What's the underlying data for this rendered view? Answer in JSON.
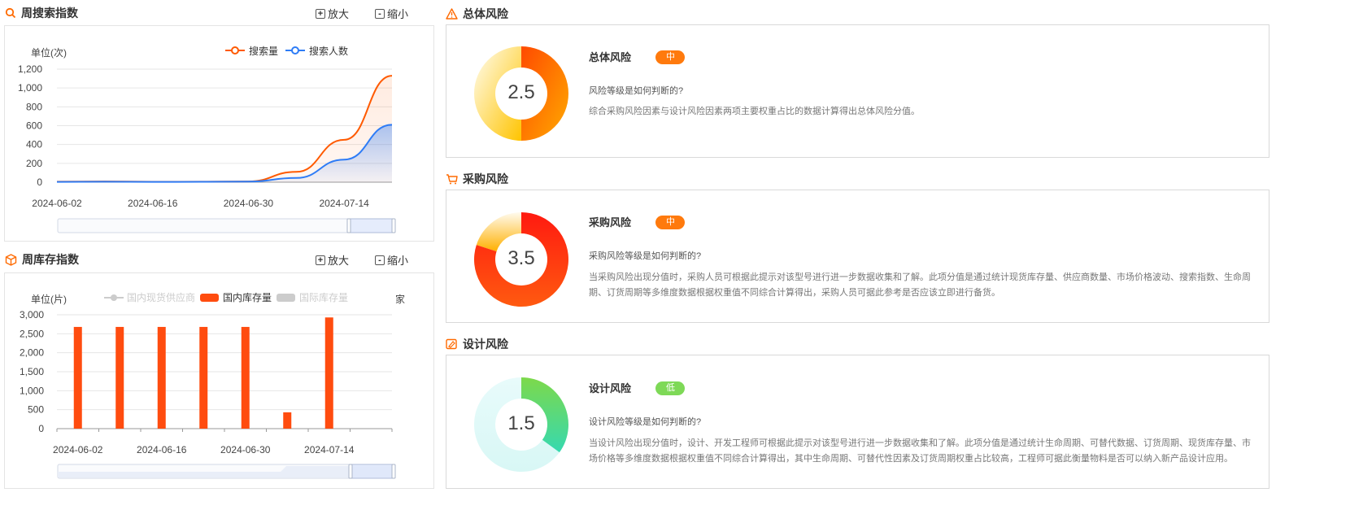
{
  "search_section": {
    "title": "周搜索指数",
    "zoom_in": "放大",
    "zoom_out": "缩小",
    "unit": "单位(次)",
    "zoom_in_symbol": "+",
    "zoom_out_symbol": "-"
  },
  "inventory_section": {
    "title": "周库存指数",
    "zoom_in": "放大",
    "zoom_out": "缩小",
    "unit": "单位(片)",
    "right_unit": "家",
    "zoom_in_symbol": "+",
    "zoom_out_symbol": "-"
  },
  "chart_data": [
    {
      "type": "line",
      "x": [
        "2024-06-02",
        "2024-06-09",
        "2024-06-16",
        "2024-06-23",
        "2024-06-30",
        "2024-07-07",
        "2024-07-14",
        "2024-07-21"
      ],
      "x_tick_labels": [
        "2024-06-02",
        "2024-06-16",
        "2024-06-30",
        "2024-07-14"
      ],
      "series": [
        {
          "name": "搜索量",
          "color": "#ff5a00",
          "values": [
            5,
            8,
            4,
            5,
            8,
            110,
            450,
            1130
          ]
        },
        {
          "name": "搜索人数",
          "color": "#2e7cf6",
          "values": [
            3,
            5,
            3,
            4,
            6,
            45,
            240,
            610
          ]
        }
      ],
      "ylim": [
        0,
        1200
      ],
      "yticks": [
        "0",
        "200",
        "400",
        "600",
        "800",
        "1,000",
        "1,200"
      ],
      "ylabel": "单位(次)",
      "legend_position": "top",
      "grid": true
    },
    {
      "type": "bar",
      "categories": [
        "2024-06-02",
        "2024-06-09",
        "2024-06-16",
        "2024-06-23",
        "2024-06-30",
        "2024-07-07",
        "2024-07-14"
      ],
      "x_tick_labels": [
        "2024-06-02",
        "2024-06-16",
        "2024-06-30",
        "2024-07-14"
      ],
      "series": [
        {
          "name": "国内现货供应商",
          "color": "#cccccc",
          "values": [],
          "disabled": true
        },
        {
          "name": "国内库存量",
          "color": "#ff4c0f",
          "values": [
            2680,
            2680,
            2680,
            2680,
            2680,
            430,
            2930
          ]
        },
        {
          "name": "国际库存量",
          "color": "#cccccc",
          "values": [],
          "disabled": true
        }
      ],
      "ylim": [
        0,
        3000
      ],
      "yticks": [
        "0",
        "500",
        "1,000",
        "1,500",
        "2,000",
        "2,500",
        "3,000"
      ],
      "ylabel": "单位(片)",
      "legend_position": "top",
      "grid": true
    }
  ],
  "risks": [
    {
      "section_title": "总体风险",
      "icon": "warning-icon",
      "score": "2.5",
      "score_fraction": 0.5,
      "name": "总体风险",
      "level": "中",
      "level_color": "#ff7a0d",
      "question": "风险等级是如何判断的?",
      "description": "综合采购风险因素与设计风险因素两项主要权重占比的数据计算得出总体风险分值。"
    },
    {
      "section_title": "采购风险",
      "icon": "cart-icon",
      "score": "3.5",
      "score_fraction": 0.7,
      "name": "采购风险",
      "level": "中",
      "level_color": "#ff7a0d",
      "question": "采购风险等级是如何判断的?",
      "description": "当采购风险出现分值时，采购人员可根据此提示对该型号进行进一步数据收集和了解。此项分值是通过统计现货库存量、供应商数量、市场价格波动、搜索指数、生命周期、订货周期等多维度数据根据权重值不同综合计算得出，采购人员可据此参考是否应该立即进行备货。"
    },
    {
      "section_title": "设计风险",
      "icon": "design-icon",
      "score": "1.5",
      "score_fraction": 0.3,
      "name": "设计风险",
      "level": "低",
      "level_color": "#7ed957",
      "question": "设计风险等级是如何判断的?",
      "description": "当设计风险出现分值时，设计、开发工程师可根据此提示对该型号进行进一步数据收集和了解。此项分值是通过统计生命周期、可替代数据、订货周期、现货库存量、市场价格等多维度数据根据权重值不同综合计算得出，其中生命周期、可替代性因素及订货周期权重占比较高，工程师可据此衡量物料是否可以纳入新产品设计应用。"
    }
  ]
}
